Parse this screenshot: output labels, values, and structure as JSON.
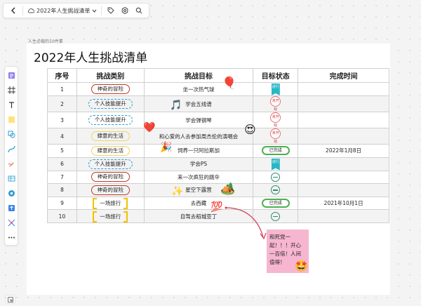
{
  "topbar": {
    "doc_title": "2022年人生挑战清单"
  },
  "board": {
    "small_label": "人生必做的10件事",
    "title": "2022年人生挑战清单"
  },
  "table": {
    "headers": [
      "序号",
      "挑战类别",
      "挑战目标",
      "目标状态",
      "完成时间"
    ],
    "rows": [
      {
        "num": "1",
        "category": "神奇的冒险",
        "cat_style": "red",
        "goal": "坐一次热气球",
        "status": "ribbon",
        "status_text": "进行",
        "time": ""
      },
      {
        "num": "2",
        "category": "个人技能提升",
        "cat_style": "blue",
        "goal": "学会五线谱",
        "status": "todo",
        "status_text": "未开始",
        "time": ""
      },
      {
        "num": "3",
        "category": "个人技能提升",
        "cat_style": "blue",
        "goal": "学会弹钢琴",
        "status": "todo",
        "status_text": "未开始",
        "time": ""
      },
      {
        "num": "4",
        "category": "肆意的生活",
        "cat_style": "yellow",
        "goal": "和心爱的人去参加周杰伦的演唱会",
        "status": "todo",
        "status_text": "未开始",
        "time": ""
      },
      {
        "num": "5",
        "category": "肆意的生活",
        "cat_style": "yellow",
        "goal": "饲养一只阿拉斯加",
        "status": "done",
        "status_text": "已完成",
        "time": "2022年1月8日"
      },
      {
        "num": "6",
        "category": "个人技能提升",
        "cat_style": "blue",
        "goal": "学会PS",
        "status": "ribbon",
        "status_text": "进行",
        "time": ""
      },
      {
        "num": "7",
        "category": "神奇的冒险",
        "cat_style": "red",
        "goal": "来一次疯狂的跳伞",
        "status": "minus",
        "status_text": "",
        "time": ""
      },
      {
        "num": "8",
        "category": "神奇的冒险",
        "cat_style": "red",
        "goal": "星空下露营",
        "status": "minus",
        "status_text": "",
        "time": ""
      },
      {
        "num": "9",
        "category": "一场旅行",
        "cat_style": "bracket",
        "goal": "去西藏",
        "status": "done",
        "status_text": "已完成",
        "time": "2021年10月1日"
      },
      {
        "num": "10",
        "category": "一场旅行",
        "cat_style": "bracket",
        "goal": "自驾去稻城亚丁",
        "status": "minus",
        "status_text": "",
        "time": ""
      }
    ]
  },
  "emojis": {
    "balloon": "🎈",
    "music": "🎵",
    "heart": "❤️",
    "star_eyes": "😍",
    "party": "🎉",
    "sparkle": "✨",
    "camping": "🏕️",
    "hundred": "💯",
    "star_face": "🤩"
  },
  "sticky": {
    "text": "和死党一起！！！开心一百倍！人间值得！"
  },
  "colors": {
    "red": "#c0392b",
    "blue": "#2b9bd2",
    "yellow": "#f0d55a",
    "bracket": "#f2c200",
    "done": "#4caf50",
    "sticky": "#f7b6cf"
  }
}
